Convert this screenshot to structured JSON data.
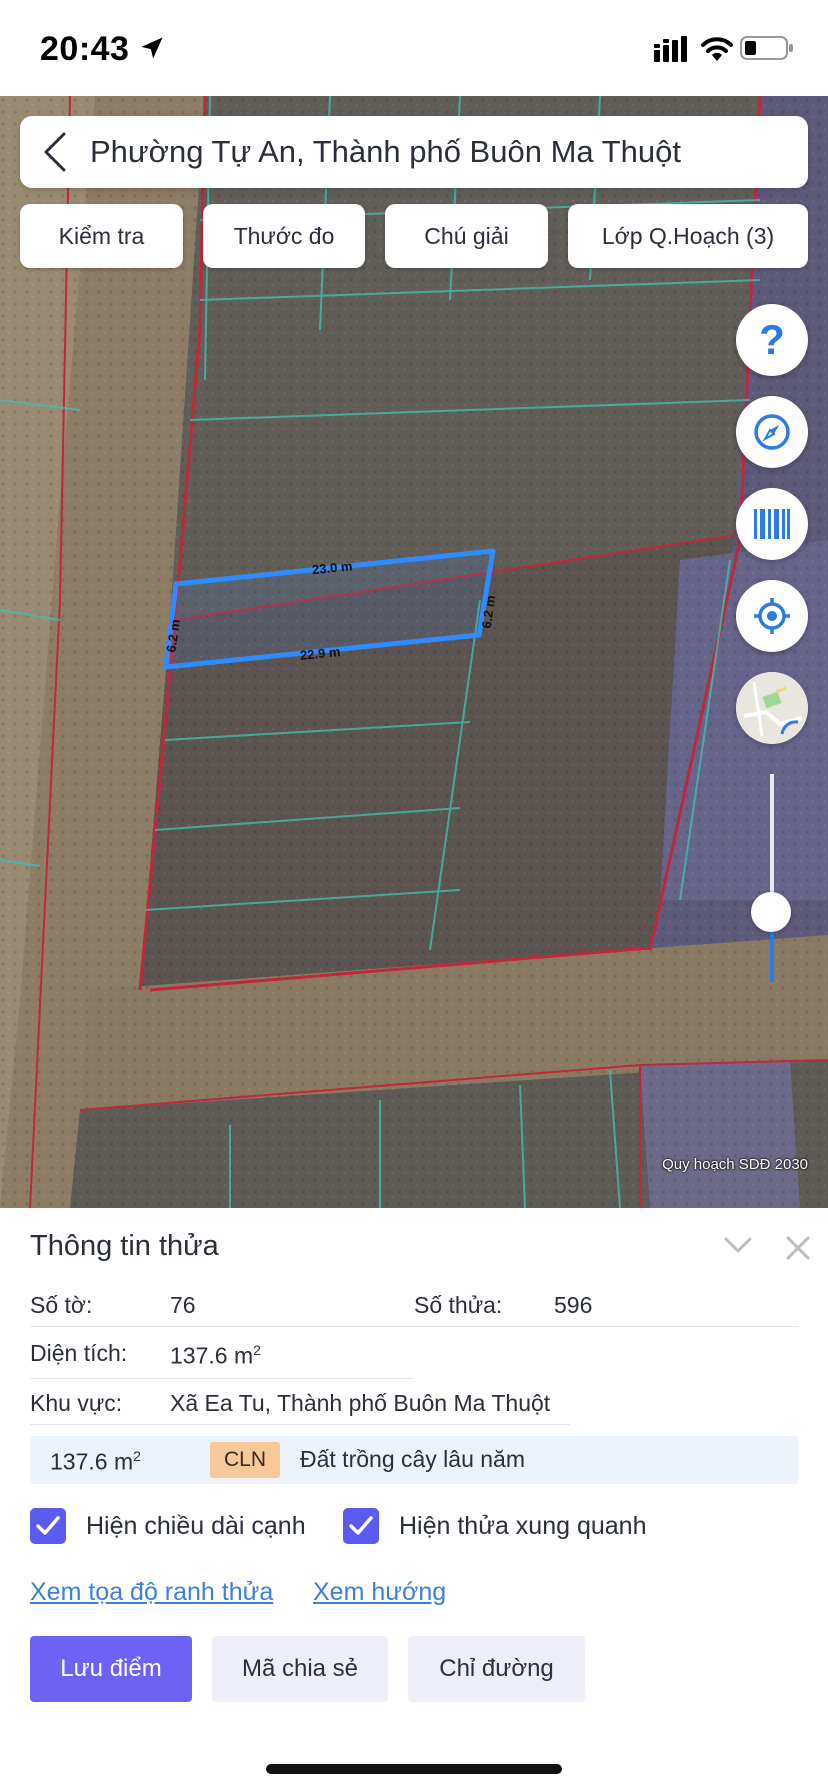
{
  "status_bar": {
    "time": "20:43"
  },
  "header": {
    "location_title": "Phường Tự An, Thành phố Buôn Ma Thuột"
  },
  "toolbar": {
    "check_label": "Kiểm tra",
    "ruler_label": "Thước đo",
    "legend_label": "Chú giải",
    "layers_label": "Lớp Q.Hoạch (3)"
  },
  "map": {
    "plot_edges": {
      "top": "23.0 m",
      "bottom": "22.9 m",
      "left": "6.2 m",
      "right": "6.2 m"
    },
    "layer_caption": "Quy hoạch SDĐ 2030",
    "zoom_level_fraction": 0.33,
    "colors": {
      "parcel_outline": "#2f8cff",
      "zone_border": "#c0283a",
      "grid_line": "#3fbfb0"
    }
  },
  "panel": {
    "title": "Thông tin thửa",
    "sheet_label": "Số tờ:",
    "sheet_value": "76",
    "parcel_label": "Số thửa:",
    "parcel_value": "596",
    "area_label": "Diện tích:",
    "area_value": "137.6 m",
    "area_unit_sup": "2",
    "region_label": "Khu vực:",
    "region_value": "Xã Ea Tu, Thành phố Buôn Ma Thuột",
    "land_use": {
      "area": "137.6 m",
      "area_sup": "2",
      "code": "CLN",
      "description": "Đất trồng cây lâu năm"
    },
    "show_edges_label": "Hiện chiều dài cạnh",
    "show_neighbors_label": "Hiện thửa xung quanh",
    "coords_link": "Xem tọa độ ranh thửa",
    "direction_link": "Xem hướng",
    "save_button": "Lưu điểm",
    "share_button": "Mã chia sẻ",
    "route_button": "Chỉ đường"
  }
}
